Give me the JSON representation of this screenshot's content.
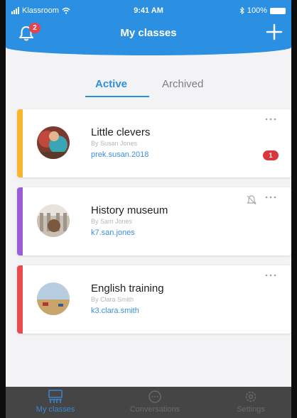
{
  "status_bar": {
    "carrier": "Klassroom",
    "time": "9:41 AM",
    "battery": "100%"
  },
  "header": {
    "title": "My classes",
    "notification_count": "2",
    "add_icon": "plus-icon",
    "bell_icon": "bell-icon"
  },
  "tabs": {
    "active": "Active",
    "archived": "Archived"
  },
  "classes": [
    {
      "title": "Little clevers",
      "author": "By Susan Jones",
      "code": "prek.susan.2018",
      "accent": "#f7b62b",
      "unread": "1",
      "muted": false
    },
    {
      "title": "History museum",
      "author": "By Sam Jones",
      "code": "k7.san.jones",
      "accent": "#9b5cd6",
      "unread": null,
      "muted": true
    },
    {
      "title": "English training",
      "author": "By Clara Smith",
      "code": "k3.clara.smith",
      "accent": "#e84a4f",
      "unread": null,
      "muted": false
    }
  ],
  "tabbar": {
    "classes": "My classes",
    "conversations": "Conversations",
    "settings": "Settings"
  },
  "colors": {
    "primary": "#2b8fe2",
    "badge": "#e8424c"
  }
}
